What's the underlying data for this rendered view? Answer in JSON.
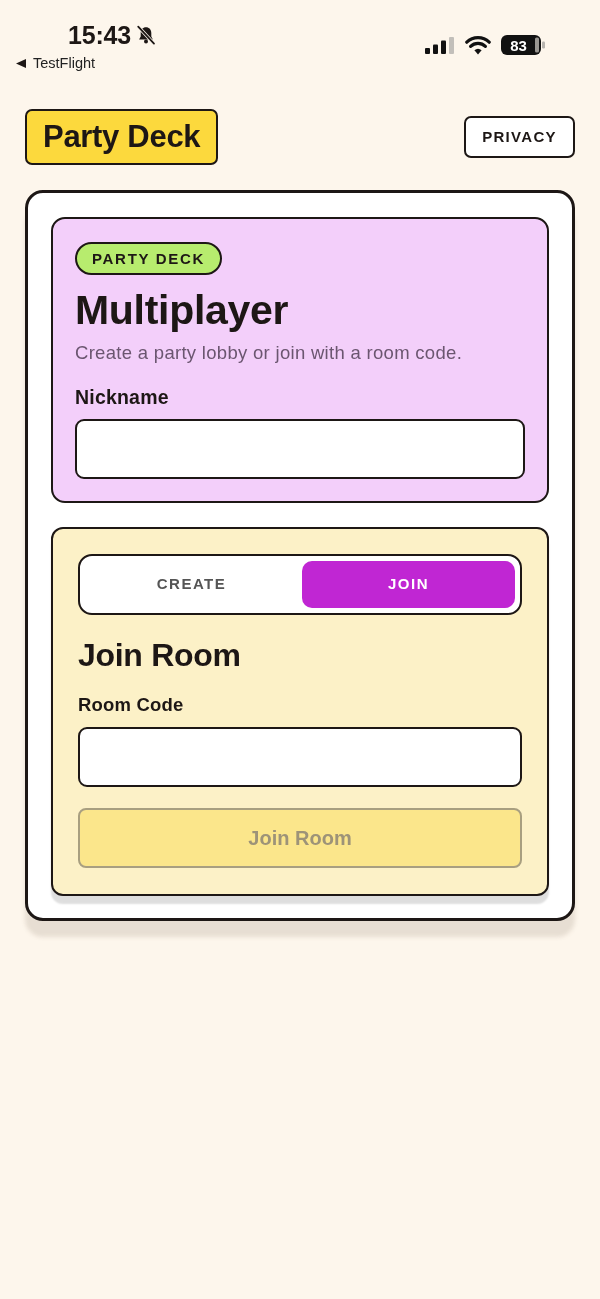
{
  "status_bar": {
    "time": "15:43",
    "back_label": "TestFlight",
    "battery": "83"
  },
  "header": {
    "logo": "Party Deck",
    "privacy_button": "PRIVACY"
  },
  "lobby": {
    "badge": "PARTY DECK",
    "title": "Multiplayer",
    "description": "Create a party lobby or join with a room code.",
    "nickname": {
      "label": "Nickname"
    }
  },
  "room": {
    "tabs": [
      {
        "label": "CREATE",
        "selected": false
      },
      {
        "label": "JOIN",
        "selected": true
      }
    ],
    "title": "Join Room",
    "room_code": {
      "label": "Room Code"
    },
    "submit": {
      "label": "Join Room",
      "disabled": true
    }
  }
}
